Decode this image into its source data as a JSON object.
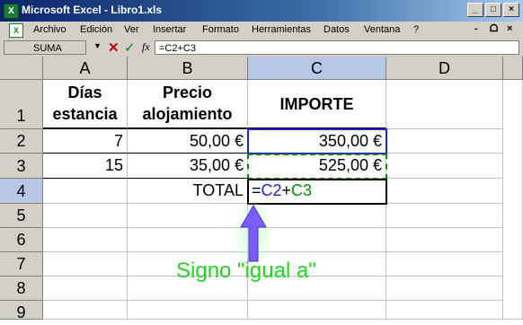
{
  "window": {
    "title": "Microsoft Excel - Libro1.xls",
    "controls": [
      "_",
      "□",
      "×"
    ]
  },
  "menu": {
    "items": [
      "Archivo",
      "Edición",
      "Ver",
      "Insertar",
      "Formato",
      "Herramientas",
      "Datos",
      "Ventana",
      "?"
    ],
    "doc_controls": [
      "-",
      "ᗝ",
      "×"
    ]
  },
  "formula_bar": {
    "name_box": "SUMA",
    "fx": "fx",
    "formula": "=C2+C3"
  },
  "sheet": {
    "columns": [
      "A",
      "B",
      "C",
      "D"
    ],
    "rows": [
      "1",
      "2",
      "3",
      "4",
      "5",
      "6",
      "7",
      "8",
      "9"
    ],
    "a1_line1": "Días",
    "a1_line2": "estancia",
    "b1_line1": "Precio",
    "b1_line2": "alojamiento",
    "c1": "IMPORTE",
    "a2": "7",
    "b2": "50,00 €",
    "c2": "350,00 €",
    "a3": "15",
    "b3": "35,00 €",
    "c3": "525,00 €",
    "b4": "TOTAL",
    "c4_eq": "=",
    "c4_ref1": "C2",
    "c4_plus": "+",
    "c4_ref2": "C3"
  },
  "annotation": {
    "text": "Signo \"igual a\""
  },
  "colors": {
    "ref_c2": "#2323c8",
    "ref_c3": "#0a8a0a",
    "annotation": "#22d322",
    "arrow": "#7a5cff"
  }
}
